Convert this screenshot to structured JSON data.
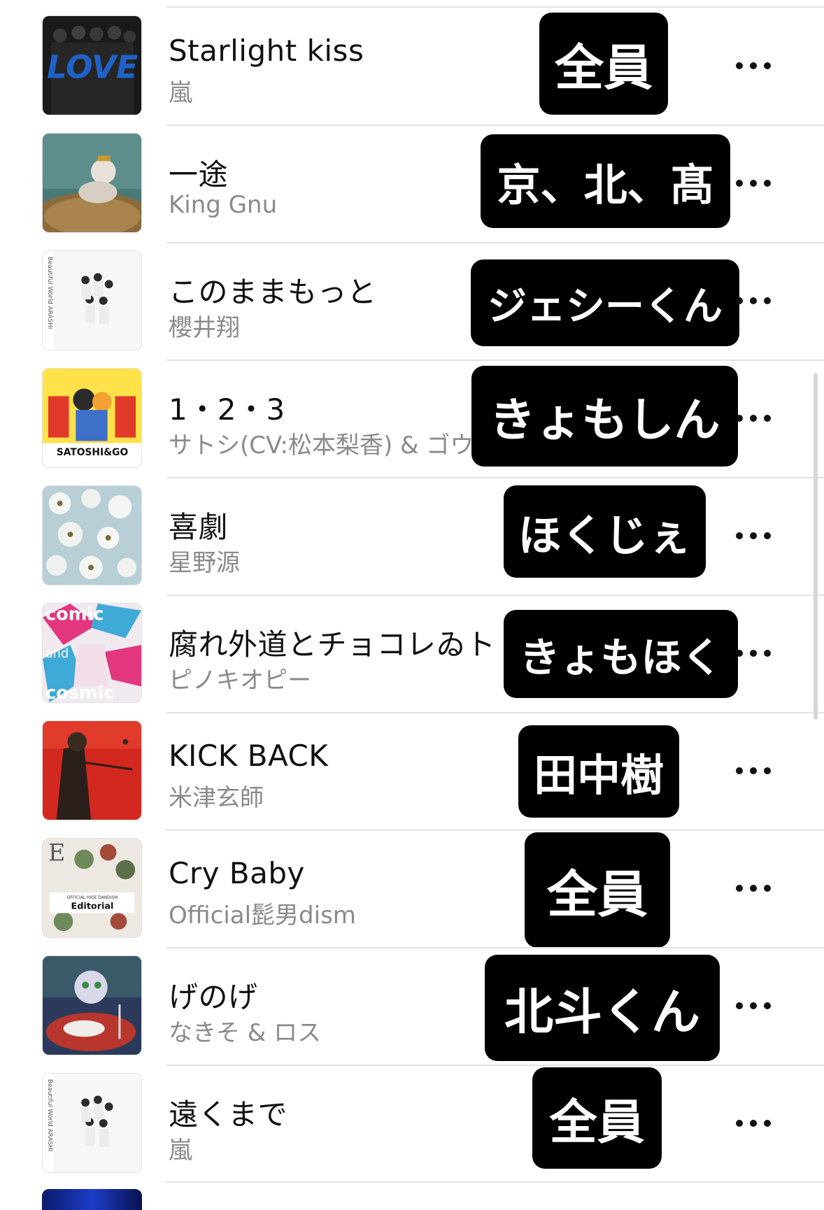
{
  "songs": [
    {
      "title": "Starlight kiss",
      "artist": "嵐",
      "tag": "全員",
      "art": "love-arashi"
    },
    {
      "title": "一途",
      "artist": "King Gnu",
      "tag": "京、北、髙",
      "art": "ichizu"
    },
    {
      "title": "このままもっと",
      "artist": "櫻井翔",
      "tag": "ジェシーくん",
      "art": "beautiful-world"
    },
    {
      "title": "1・2・3",
      "artist": "サトシ(CV:松本梨香) & ゴウ",
      "tag": "きょもしん",
      "art": "satoshi-go"
    },
    {
      "title": "喜劇",
      "artist": "星野源",
      "tag": "ほくじぇ",
      "art": "blossoms"
    },
    {
      "title": "腐れ外道とチョコレゐト",
      "artist": "ピノキオピー",
      "tag": "きょもほく",
      "art": "comic-cosmic"
    },
    {
      "title": "KICK BACK",
      "artist": "米津玄師",
      "tag": "田中樹",
      "art": "kick-back"
    },
    {
      "title": "Cry Baby",
      "artist": "Official髭男dism",
      "tag": "全員",
      "art": "editorial"
    },
    {
      "title": "げのげ",
      "artist": "なきそ & ロス",
      "tag": "北斗くん",
      "art": "genoge"
    },
    {
      "title": "遠くまで",
      "artist": "嵐",
      "tag": "全員",
      "art": "beautiful-world"
    }
  ],
  "art_text": {
    "love": "LOVE",
    "beautiful_world": "Beautiful World ARASHI",
    "satoshi_go": "SATOSHI&GO",
    "comic": "comic",
    "and": "and",
    "cosmic": "cosmic",
    "official": "OFFICIAL HIGE DANDISM",
    "editorial": "Editorial",
    "e_letter": "E"
  },
  "colors": {
    "title": "#111111",
    "artist": "#8a8a8e",
    "separator": "#e3e3e6",
    "tag_bg": "#000000",
    "tag_text": "#ffffff"
  },
  "icons": {
    "more": "ellipsis-icon"
  }
}
